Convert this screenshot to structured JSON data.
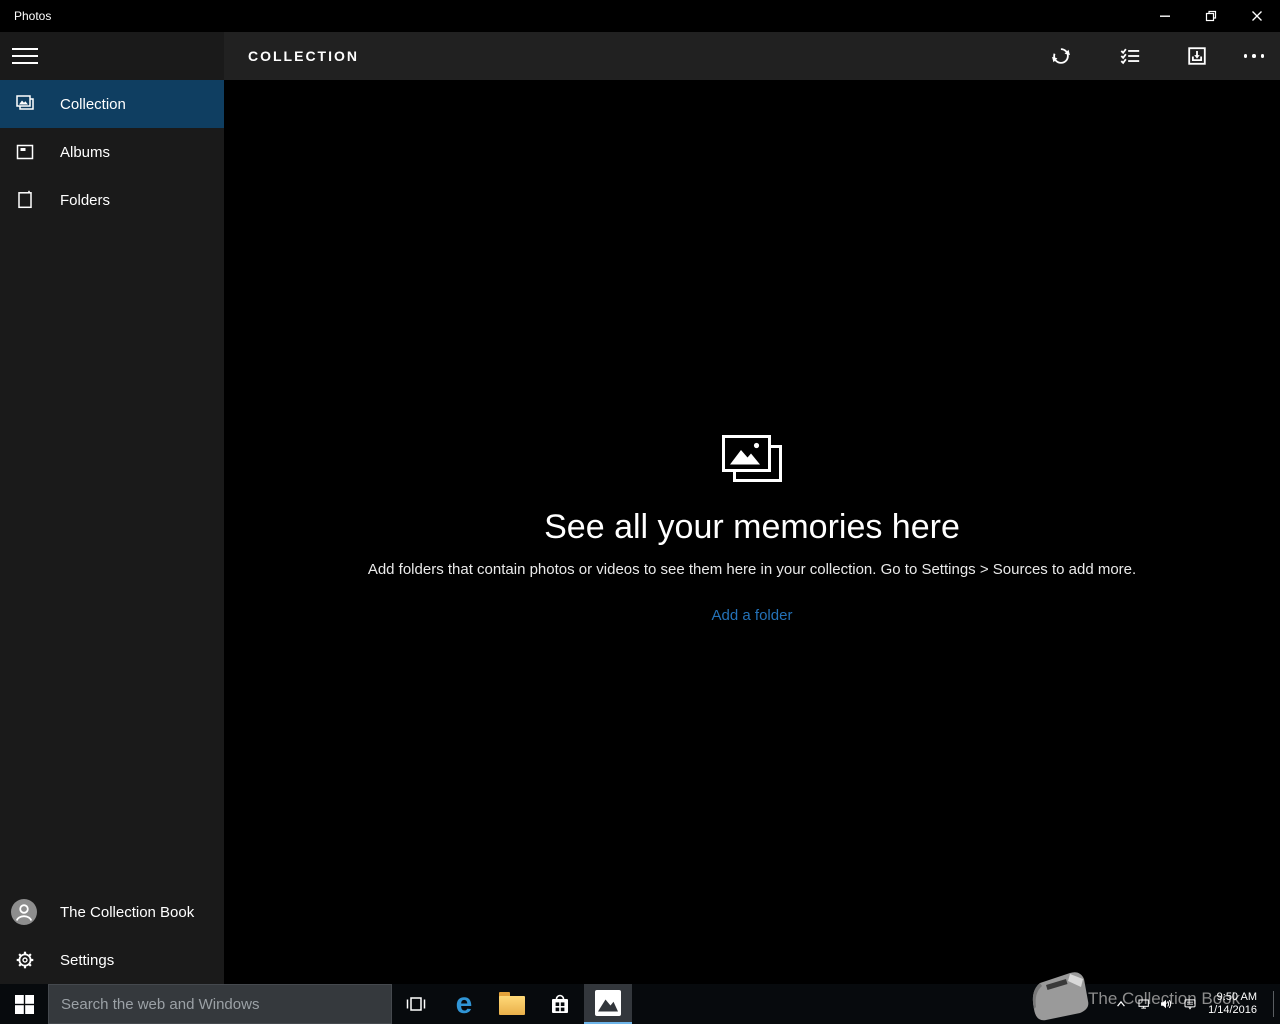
{
  "window": {
    "title": "Photos",
    "controls": [
      "minimize",
      "restore",
      "close"
    ]
  },
  "app_header": {
    "title": "COLLECTION",
    "toolbar_icons": [
      "sync-icon",
      "select-icon",
      "import-icon",
      "see-more-icon"
    ]
  },
  "sidebar": {
    "items": [
      {
        "label": "Collection",
        "icon": "collection-photos-icon",
        "selected": true
      },
      {
        "label": "Albums",
        "icon": "album-icon",
        "selected": false
      },
      {
        "label": "Folders",
        "icon": "folder-page-icon",
        "selected": false
      }
    ],
    "account": {
      "label": "The Collection Book",
      "icon": "person-avatar-icon"
    },
    "settings": {
      "label": "Settings",
      "icon": "gear-icon"
    }
  },
  "empty_state": {
    "heading": "See all your memories here",
    "description": "Add folders that contain photos or videos to see them here in your collection. Go to Settings > Sources to add more.",
    "action": "Add a folder",
    "icon": "stacked-photos-icon"
  },
  "taskbar": {
    "search_placeholder": "Search the web and Windows",
    "edge_glyph": "e",
    "buttons": [
      "start",
      "task-view",
      "edge",
      "file-explorer",
      "store",
      "photos"
    ],
    "active_button": "photos",
    "tray_icons": [
      "chevron-up-icon",
      "display-network-icon",
      "volume-icon",
      "action-center-icon"
    ],
    "clock": {
      "time": "9:50 AM",
      "date": "1/14/2016"
    }
  },
  "watermark": {
    "label": "The Collection Book",
    "icon": "book-icon"
  },
  "colors": {
    "selected_nav": "#0f3e61",
    "link": "#2472b8",
    "header_strip": "#212121",
    "sidebar_bg": "#1a1a1a",
    "taskbar_bg": "#070a0d",
    "active_underline": "#6db4e8",
    "edge_blue": "#3095d6"
  }
}
